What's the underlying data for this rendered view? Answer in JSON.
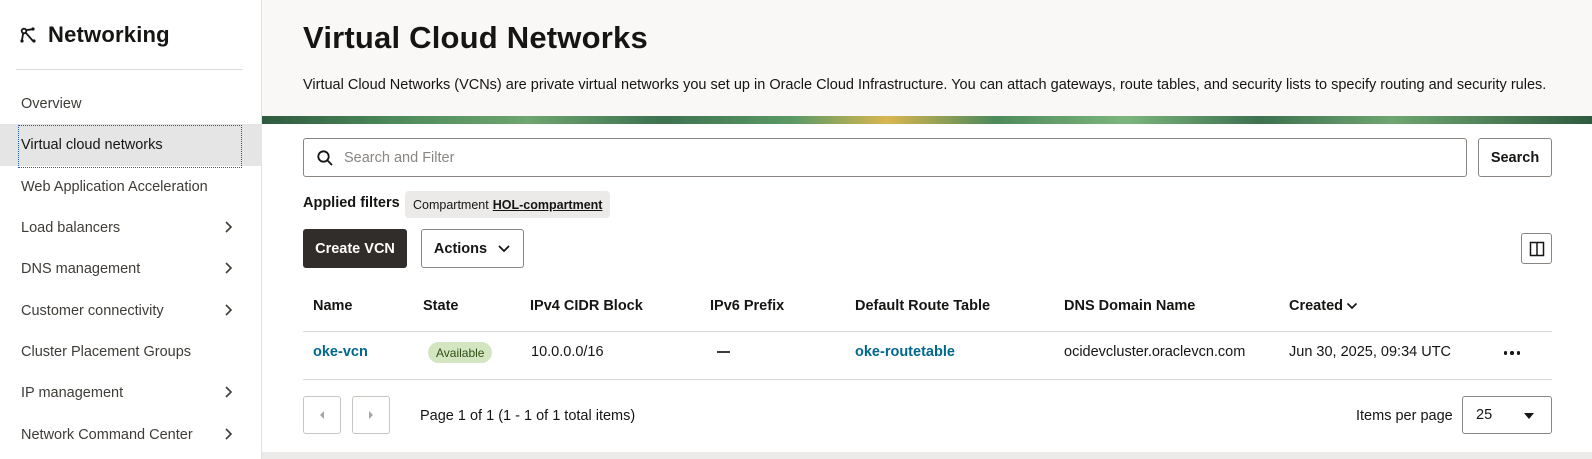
{
  "sidebar": {
    "title": "Networking",
    "icon": "network-icon",
    "items": [
      {
        "label": "Overview",
        "has_submenu": false
      },
      {
        "label": "Virtual cloud networks",
        "has_submenu": false,
        "active": true
      },
      {
        "label": "Web Application Acceleration",
        "has_submenu": false
      },
      {
        "label": "Load balancers",
        "has_submenu": true
      },
      {
        "label": "DNS management",
        "has_submenu": true
      },
      {
        "label": "Customer connectivity",
        "has_submenu": true
      },
      {
        "label": "Cluster Placement Groups",
        "has_submenu": false
      },
      {
        "label": "IP management",
        "has_submenu": true
      },
      {
        "label": "Network Command Center",
        "has_submenu": true
      }
    ]
  },
  "page": {
    "title": "Virtual Cloud Networks",
    "description": "Virtual Cloud Networks (VCNs) are private virtual networks you set up in Oracle Cloud Infrastructure. You can attach gateways, route tables, and security lists to specify routing and security rules."
  },
  "search": {
    "placeholder": "Search and Filter",
    "value": "",
    "button_label": "Search"
  },
  "filters": {
    "label": "Applied filters",
    "chips": [
      {
        "key": "Compartment",
        "value": "HOL-compartment"
      }
    ]
  },
  "toolbar": {
    "create_label": "Create VCN",
    "actions_label": "Actions"
  },
  "table": {
    "columns": [
      "Name",
      "State",
      "IPv4 CIDR Block",
      "IPv6 Prefix",
      "Default Route Table",
      "DNS Domain Name",
      "Created"
    ],
    "sorted_column": "Created",
    "rows": [
      {
        "name": "oke-vcn",
        "state": "Available",
        "ipv4": "10.0.0.0/16",
        "ipv6": "—",
        "route_table": "oke-routetable",
        "dns": "ocidevcluster.oraclevcn.com",
        "created": "Jun 30, 2025, 09:34 UTC"
      }
    ]
  },
  "pagination": {
    "text": "Page 1 of 1 (1 - 1 of 1 total items)",
    "items_per_page_label": "Items per page",
    "items_per_page": "25"
  },
  "colors": {
    "primary_button": "#312d2a",
    "link": "#00688c",
    "badge_bg": "#d4e5c2",
    "active_nav_bg": "#e5e5e5"
  }
}
